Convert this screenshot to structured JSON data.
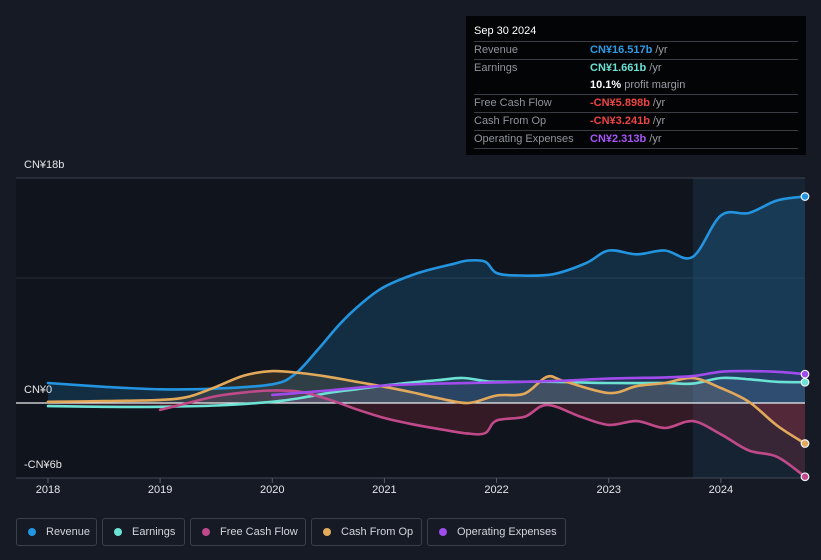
{
  "tooltip": {
    "date": "Sep 30 2024",
    "rows": [
      {
        "label": "Revenue",
        "value": "CN¥16.517b",
        "unit": "/yr",
        "color": "#2d9be6"
      },
      {
        "label": "Earnings",
        "value": "CN¥1.661b",
        "unit": "/yr",
        "color": "#6ce2d4"
      },
      {
        "label": "",
        "value": "10.1%",
        "unit": "profit margin",
        "color": "#ffffff"
      },
      {
        "label": "Free Cash Flow",
        "value": "-CN¥5.898b",
        "unit": "/yr",
        "color": "#ef4444"
      },
      {
        "label": "Cash From Op",
        "value": "-CN¥3.241b",
        "unit": "/yr",
        "color": "#ef4444"
      },
      {
        "label": "Operating Expenses",
        "value": "CN¥2.313b",
        "unit": "/yr",
        "color": "#a855f7"
      }
    ]
  },
  "legend": {
    "items": [
      {
        "label": "Revenue",
        "color": "#2394df",
        "icon": "dot"
      },
      {
        "label": "Earnings",
        "color": "#6ce2d4",
        "icon": "dot"
      },
      {
        "label": "Free Cash Flow",
        "color": "#c0498a",
        "icon": "dot"
      },
      {
        "label": "Cash From Op",
        "color": "#e3a95a",
        "icon": "dot"
      },
      {
        "label": "Operating Expenses",
        "color": "#a04cec",
        "icon": "dot"
      }
    ]
  },
  "chart_data": {
    "type": "area",
    "title": "",
    "units": "CN¥ billions",
    "xlabel": "",
    "ylabel": "",
    "x_range": [
      2017.715,
      2024.75
    ],
    "y_range": [
      -6,
      18
    ],
    "grid": true,
    "gridlines": [
      18,
      10
    ],
    "zero_line": 0,
    "highlight_range": [
      2023.75,
      2024.75
    ],
    "legend_position": "bottom-left",
    "y_ticks": [
      {
        "value": 18,
        "label": "CN¥18b"
      },
      {
        "value": 0,
        "label": "CN¥0"
      },
      {
        "value": -6,
        "label": "-CN¥6b"
      }
    ],
    "x_ticks": [
      {
        "value": 2018,
        "label": "2018"
      },
      {
        "value": 2019,
        "label": "2019"
      },
      {
        "value": 2020,
        "label": "2020"
      },
      {
        "value": 2021,
        "label": "2021"
      },
      {
        "value": 2022,
        "label": "2022"
      },
      {
        "value": 2023,
        "label": "2023"
      },
      {
        "value": 2024,
        "label": "2024"
      }
    ],
    "series": [
      {
        "name": "Revenue",
        "key": "revenue",
        "color": "#2394df",
        "area_opacity": 0.2,
        "points": [
          [
            2018.0,
            1.6
          ],
          [
            2018.5,
            1.3
          ],
          [
            2019.0,
            1.1
          ],
          [
            2019.5,
            1.15
          ],
          [
            2020.0,
            1.5
          ],
          [
            2020.2,
            2.3
          ],
          [
            2020.4,
            4.2
          ],
          [
            2020.6,
            6.3
          ],
          [
            2020.8,
            8.0
          ],
          [
            2021.0,
            9.3
          ],
          [
            2021.3,
            10.4
          ],
          [
            2021.6,
            11.1
          ],
          [
            2021.75,
            11.4
          ],
          [
            2021.9,
            11.3
          ],
          [
            2022.0,
            10.4
          ],
          [
            2022.2,
            10.2
          ],
          [
            2022.5,
            10.3
          ],
          [
            2022.8,
            11.2
          ],
          [
            2023.0,
            12.2
          ],
          [
            2023.25,
            11.9
          ],
          [
            2023.5,
            12.2
          ],
          [
            2023.75,
            11.7
          ],
          [
            2024.0,
            15.0
          ],
          [
            2024.25,
            15.2
          ],
          [
            2024.5,
            16.2
          ],
          [
            2024.75,
            16.517
          ]
        ]
      },
      {
        "name": "Earnings",
        "key": "earnings",
        "color": "#6ce2d4",
        "area_opacity": 0.12,
        "points": [
          [
            2018.0,
            -0.25
          ],
          [
            2018.5,
            -0.3
          ],
          [
            2019.0,
            -0.3
          ],
          [
            2019.5,
            -0.2
          ],
          [
            2020.0,
            0.1
          ],
          [
            2020.25,
            0.4
          ],
          [
            2020.5,
            0.8
          ],
          [
            2020.75,
            1.1
          ],
          [
            2021.0,
            1.4
          ],
          [
            2021.25,
            1.65
          ],
          [
            2021.5,
            1.85
          ],
          [
            2021.7,
            2.0
          ],
          [
            2021.9,
            1.75
          ],
          [
            2022.0,
            1.7
          ],
          [
            2022.5,
            1.7
          ],
          [
            2023.0,
            1.6
          ],
          [
            2023.5,
            1.6
          ],
          [
            2023.75,
            1.55
          ],
          [
            2024.0,
            2.0
          ],
          [
            2024.25,
            1.9
          ],
          [
            2024.5,
            1.7
          ],
          [
            2024.75,
            1.661
          ]
        ]
      },
      {
        "name": "Free Cash Flow",
        "key": "fcf",
        "color": "#c0498a",
        "area_opacity": 0.14,
        "points": [
          [
            2019.0,
            -0.55
          ],
          [
            2019.25,
            0.0
          ],
          [
            2019.5,
            0.55
          ],
          [
            2019.75,
            0.85
          ],
          [
            2020.0,
            1.0
          ],
          [
            2020.25,
            0.9
          ],
          [
            2020.5,
            0.3
          ],
          [
            2020.75,
            -0.5
          ],
          [
            2021.0,
            -1.2
          ],
          [
            2021.25,
            -1.7
          ],
          [
            2021.5,
            -2.1
          ],
          [
            2021.75,
            -2.45
          ],
          [
            2021.9,
            -2.4
          ],
          [
            2022.0,
            -1.4
          ],
          [
            2022.25,
            -1.1
          ],
          [
            2022.45,
            -0.15
          ],
          [
            2022.75,
            -1.1
          ],
          [
            2023.0,
            -1.75
          ],
          [
            2023.25,
            -1.45
          ],
          [
            2023.5,
            -2.0
          ],
          [
            2023.75,
            -1.45
          ],
          [
            2024.0,
            -2.5
          ],
          [
            2024.25,
            -3.8
          ],
          [
            2024.5,
            -4.3
          ],
          [
            2024.75,
            -5.898
          ]
        ]
      },
      {
        "name": "Cash From Op",
        "key": "cfo",
        "color": "#e3a95a",
        "area_opacity": 0.14,
        "points": [
          [
            2018.0,
            0.1
          ],
          [
            2018.5,
            0.15
          ],
          [
            2019.0,
            0.25
          ],
          [
            2019.25,
            0.5
          ],
          [
            2019.5,
            1.3
          ],
          [
            2019.75,
            2.2
          ],
          [
            2020.0,
            2.55
          ],
          [
            2020.25,
            2.4
          ],
          [
            2020.5,
            2.1
          ],
          [
            2020.75,
            1.7
          ],
          [
            2021.0,
            1.3
          ],
          [
            2021.25,
            0.85
          ],
          [
            2021.5,
            0.35
          ],
          [
            2021.75,
            0.0
          ],
          [
            2022.0,
            0.6
          ],
          [
            2022.25,
            0.75
          ],
          [
            2022.45,
            2.1
          ],
          [
            2022.6,
            1.75
          ],
          [
            2023.0,
            0.8
          ],
          [
            2023.25,
            1.35
          ],
          [
            2023.5,
            1.6
          ],
          [
            2023.75,
            2.0
          ],
          [
            2024.0,
            1.2
          ],
          [
            2024.25,
            0.1
          ],
          [
            2024.5,
            -1.8
          ],
          [
            2024.75,
            -3.241
          ]
        ]
      },
      {
        "name": "Operating Expenses",
        "key": "opex",
        "color": "#a04cec",
        "area_opacity": 0.1,
        "points": [
          [
            2020.0,
            0.65
          ],
          [
            2020.5,
            1.0
          ],
          [
            2021.0,
            1.4
          ],
          [
            2021.5,
            1.55
          ],
          [
            2022.0,
            1.65
          ],
          [
            2022.5,
            1.75
          ],
          [
            2023.0,
            1.95
          ],
          [
            2023.5,
            2.05
          ],
          [
            2023.75,
            2.15
          ],
          [
            2024.0,
            2.5
          ],
          [
            2024.25,
            2.55
          ],
          [
            2024.5,
            2.5
          ],
          [
            2024.75,
            2.313
          ]
        ]
      }
    ]
  }
}
